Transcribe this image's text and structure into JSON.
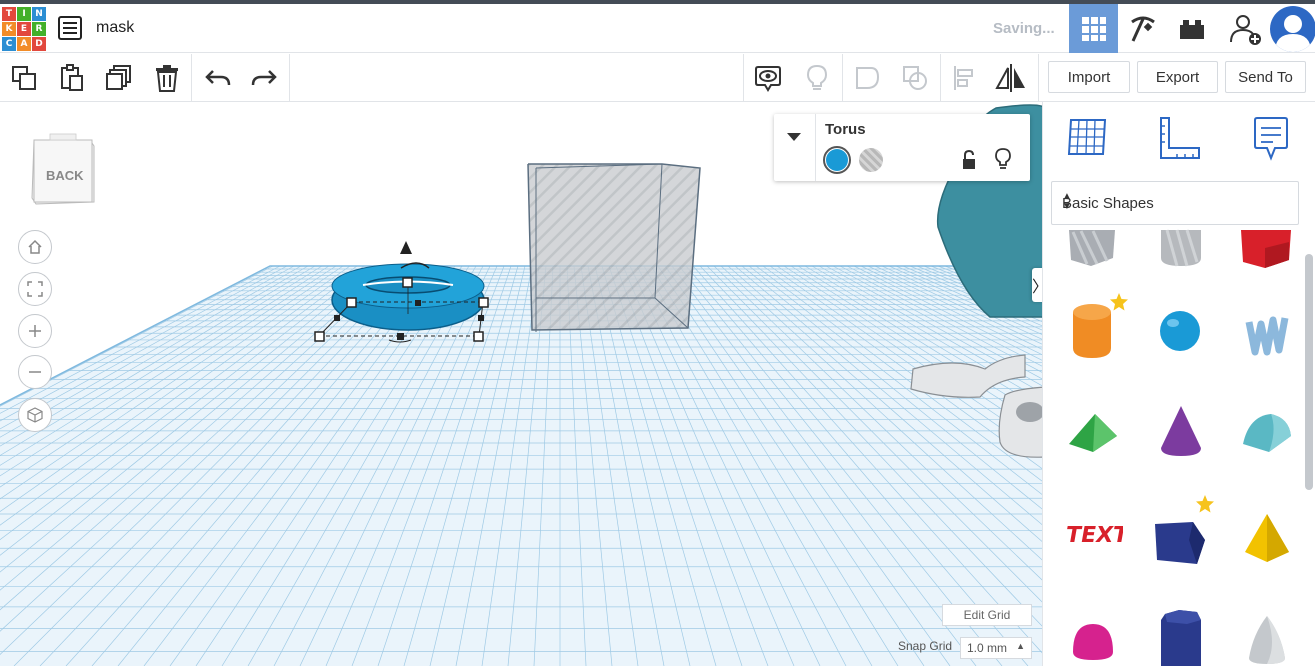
{
  "header": {
    "logo_letters": [
      "T",
      "I",
      "N",
      "K",
      "E",
      "R",
      "C",
      "A",
      "D"
    ],
    "project_name": "mask",
    "status": "Saving...",
    "buttons": [
      "3d-design-view",
      "codeblocks",
      "bricks",
      "add-user",
      "user-avatar"
    ]
  },
  "toolbar": {
    "import_label": "Import",
    "export_label": "Export",
    "send_to_label": "Send To"
  },
  "viewcube": {
    "face_label": "BACK"
  },
  "inspector": {
    "shape_name": "Torus",
    "solid_color": "#1a9ad6",
    "hole_color": "#b8b8b8"
  },
  "sidebar": {
    "category": "Basic Shapes",
    "shapes": [
      {
        "name": "box-hole",
        "color": "#a9adb3"
      },
      {
        "name": "cylinder-hole",
        "color": "#b6b9bd"
      },
      {
        "name": "box",
        "color": "#d8202a"
      },
      {
        "name": "cylinder",
        "color": "#f08c24",
        "starred": true
      },
      {
        "name": "sphere",
        "color": "#1a9ad6"
      },
      {
        "name": "scribble",
        "color": "#8cb8dc"
      },
      {
        "name": "roof",
        "color": "#2ea445"
      },
      {
        "name": "cone",
        "color": "#7c3b9f"
      },
      {
        "name": "round-roof",
        "color": "#5ab8c4"
      },
      {
        "name": "text",
        "color": "#d8202a"
      },
      {
        "name": "box-tilted",
        "color": "#2a3a8c",
        "starred": true
      },
      {
        "name": "pyramid",
        "color": "#f2c200"
      },
      {
        "name": "half-sphere",
        "color": "#d6228e"
      },
      {
        "name": "polygon",
        "color": "#2a3a8c"
      },
      {
        "name": "paraboloid",
        "color": "#c4c8cc"
      }
    ]
  },
  "grid": {
    "edit_grid_label": "Edit Grid",
    "snap_grid_label": "Snap Grid",
    "snap_value": "1.0 mm"
  },
  "colors": {
    "accent": "#6b9bd8",
    "grid_line": "#a9cde6",
    "torus": "#1a8fc4",
    "teal_object": "#3d8fa0"
  }
}
